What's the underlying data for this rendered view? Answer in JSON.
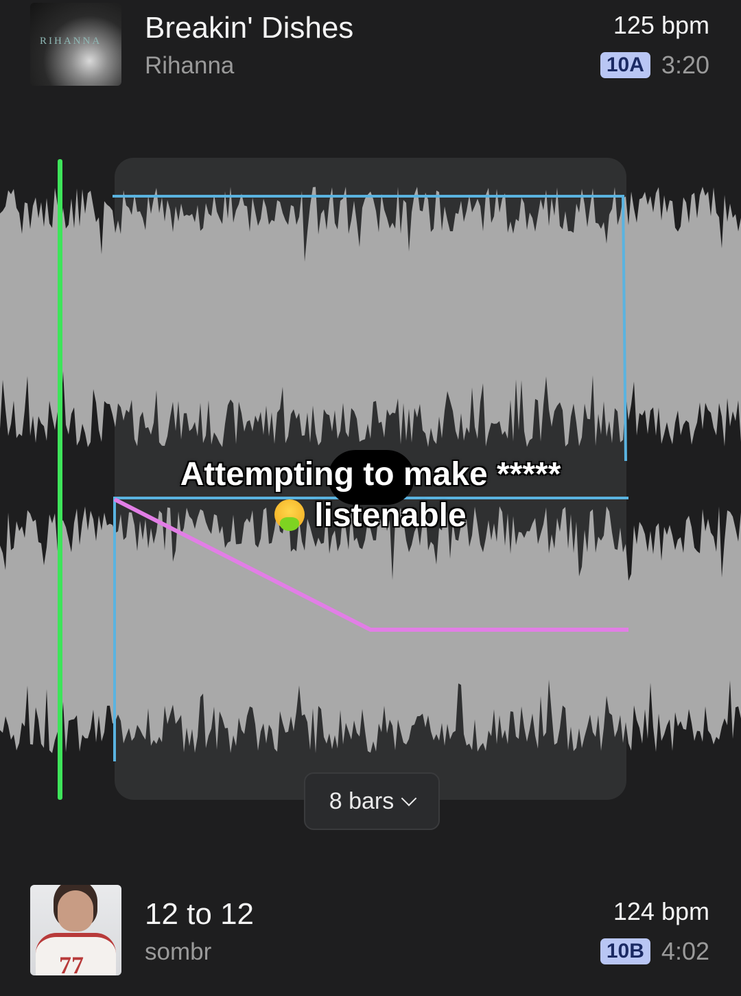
{
  "top_track": {
    "title": "Breakin' Dishes",
    "artist": "Rihanna",
    "bpm": "125 bpm",
    "key": "10A",
    "duration": "3:20",
    "art_text": "RIHANNA"
  },
  "caption": {
    "line1": "Attempting to make *****",
    "line2": "listenable"
  },
  "transition": {
    "length_label": "8 bars"
  },
  "bottom_track": {
    "title": "12 to 12",
    "artist": "sombr",
    "bpm": "124 bpm",
    "key": "10B",
    "duration": "4:02",
    "art_text": "77"
  },
  "colors": {
    "background": "#1e1e1f",
    "playhead": "#3ee45a",
    "volume_envelope": "#5ab3e0",
    "filter_envelope": "#e27ee6",
    "key_badge": "#b9c6f4"
  }
}
